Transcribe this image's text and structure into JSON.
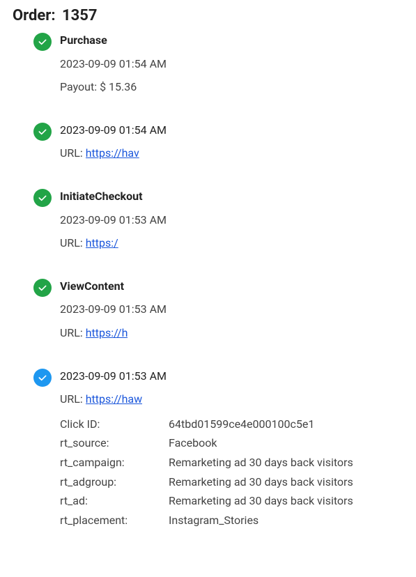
{
  "order": {
    "label": "Order:",
    "id": "1357"
  },
  "events": [
    {
      "icon": "check-green",
      "title": "Purchase",
      "time": "2023-09-09 01:54 AM",
      "payout_label": "Payout:",
      "payout_value": "$ 15.36"
    },
    {
      "icon": "check-green",
      "time": "2023-09-09 01:54 AM",
      "url_label": "URL:",
      "url": "https://hav"
    },
    {
      "icon": "check-green",
      "title": "InitiateCheckout",
      "time": "2023-09-09 01:53 AM",
      "url_label": "URL:",
      "url": "https:/"
    },
    {
      "icon": "check-green",
      "title": "ViewContent",
      "time": "2023-09-09 01:53 AM",
      "url_label": "URL:",
      "url": "https://h"
    },
    {
      "icon": "check-blue",
      "time": "2023-09-09 01:53 AM",
      "url_label": "URL:",
      "url": "https://haw",
      "details": [
        {
          "k": "Click ID:",
          "v": "64tbd01599ce4e000100c5e1"
        },
        {
          "k": "rt_source:",
          "v": "Facebook"
        },
        {
          "k": "rt_campaign:",
          "v": "Remarketing ad 30 days back visitors"
        },
        {
          "k": "rt_adgroup:",
          "v": "Remarketing ad 30 days back visitors"
        },
        {
          "k": "rt_ad:",
          "v": "Remarketing ad 30 days back visitors"
        },
        {
          "k": "rt_placement:",
          "v": "Instagram_Stories"
        }
      ]
    }
  ]
}
